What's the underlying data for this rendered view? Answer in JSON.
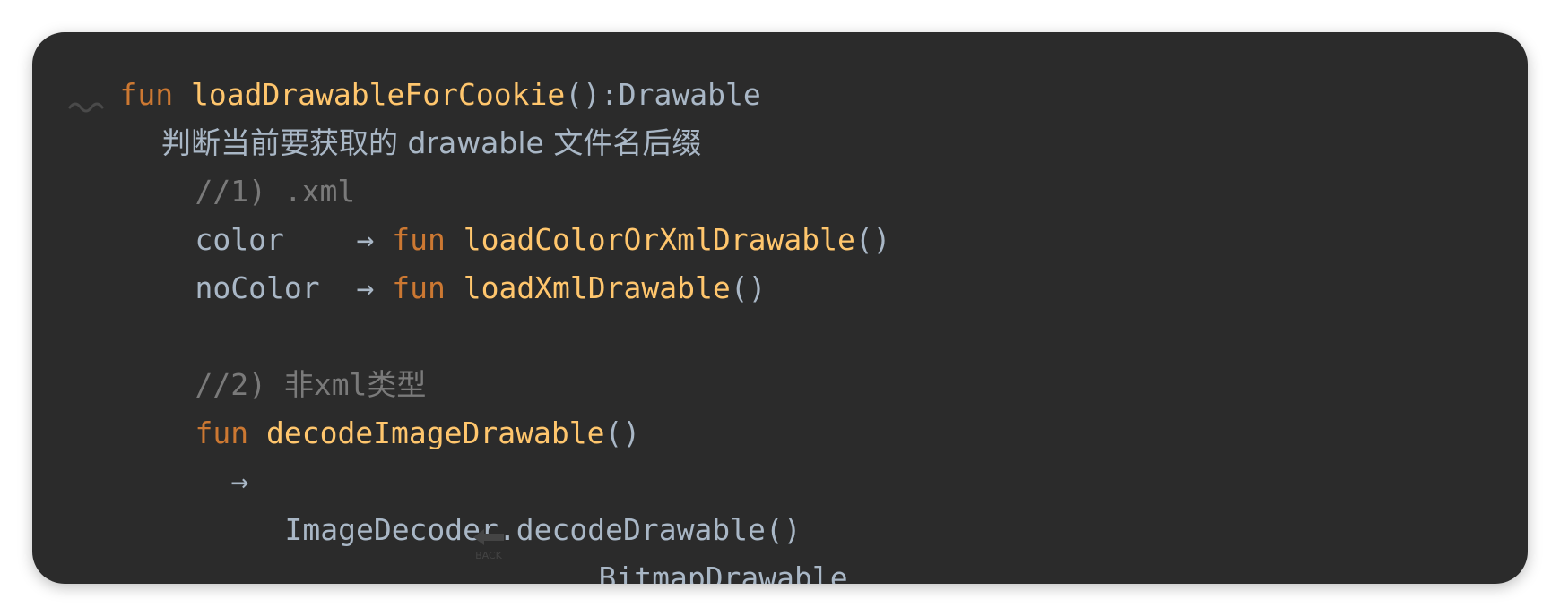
{
  "code": {
    "line1": {
      "keyword": "fun",
      "name": "loadDrawableForCookie",
      "signature": "():Drawable"
    },
    "line2": {
      "text": "判断当前要获取的 drawable 文件名后缀"
    },
    "line3": {
      "comment": "//1) .xml"
    },
    "line4": {
      "label": "color",
      "arrow": "→",
      "keyword": "fun",
      "name": "loadColorOrXmlDrawable",
      "parens": "()"
    },
    "line5": {
      "label": "noColor",
      "arrow": "→",
      "keyword": "fun",
      "name": "loadXmlDrawable",
      "parens": "()"
    },
    "line6": {
      "comment": "//2) 非xml类型"
    },
    "line7": {
      "keyword": "fun",
      "name": "decodeImageDrawable",
      "parens": "()"
    },
    "line8": {
      "arrow": "→"
    },
    "line9": {
      "text": "ImageDecoder.decodeDrawable()"
    },
    "line10": {
      "text": "BitmapDrawable",
      "icon_label": "BACK"
    }
  },
  "icons": {
    "wave": "tilde-wave-icon",
    "back": "back-arrow-icon"
  },
  "colors": {
    "background": "#2b2b2b",
    "keyword": "#cc7832",
    "function": "#ffc66d",
    "plain": "#a9b7c6",
    "comment": "#7a7a7a"
  }
}
